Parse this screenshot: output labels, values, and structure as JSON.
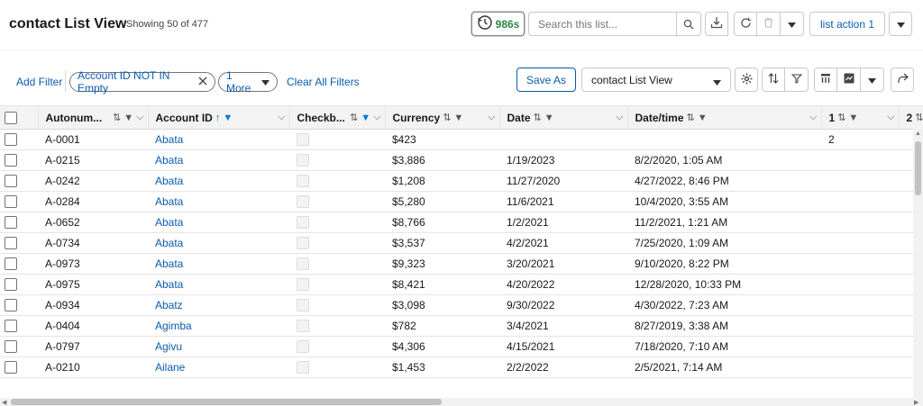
{
  "header": {
    "title": "contact List View",
    "count": "Showing 50 of 477",
    "timer": "986s",
    "search_placeholder": "Search this list...",
    "list_action": "list action 1"
  },
  "filters": {
    "add_filter": "Add Filter",
    "pills": [
      "Account ID NOT IN Empty",
      "1 More"
    ],
    "clear_all": "Clear All Filters",
    "save_as": "Save As",
    "view": "contact List View"
  },
  "table": {
    "columns": [
      "Autonum...",
      "Account ID",
      "Checkb...",
      "Currency",
      "Date",
      "Date/time",
      "1",
      "2"
    ],
    "rows": [
      {
        "auto": "A-0001",
        "account": "Abata",
        "currency": "$423",
        "date": "",
        "datetime": "",
        "c1": "2"
      },
      {
        "auto": "A-0215",
        "account": "Abata",
        "currency": "$3,886",
        "date": "1/19/2023",
        "datetime": "8/2/2020, 1:05 AM",
        "c1": ""
      },
      {
        "auto": "A-0242",
        "account": "Abata",
        "currency": "$1,208",
        "date": "11/27/2020",
        "datetime": "4/27/2022, 8:46 PM",
        "c1": ""
      },
      {
        "auto": "A-0284",
        "account": "Abata",
        "currency": "$5,280",
        "date": "11/6/2021",
        "datetime": "10/4/2020, 3:55 AM",
        "c1": ""
      },
      {
        "auto": "A-0652",
        "account": "Abata",
        "currency": "$8,766",
        "date": "1/2/2021",
        "datetime": "11/2/2021, 1:21 AM",
        "c1": ""
      },
      {
        "auto": "A-0734",
        "account": "Abata",
        "currency": "$3,537",
        "date": "4/2/2021",
        "datetime": "7/25/2020, 1:09 AM",
        "c1": ""
      },
      {
        "auto": "A-0973",
        "account": "Abata",
        "currency": "$9,323",
        "date": "3/20/2021",
        "datetime": "9/10/2020, 8:22 PM",
        "c1": ""
      },
      {
        "auto": "A-0975",
        "account": "Abata",
        "currency": "$8,421",
        "date": "4/20/2022",
        "datetime": "12/28/2020, 10:33 PM",
        "c1": ""
      },
      {
        "auto": "A-0934",
        "account": "Abatz",
        "currency": "$3,098",
        "date": "9/30/2022",
        "datetime": "4/30/2022, 7:23 AM",
        "c1": ""
      },
      {
        "auto": "A-0404",
        "account": "Agimba",
        "currency": "$782",
        "date": "3/4/2021",
        "datetime": "8/27/2019, 3:38 AM",
        "c1": ""
      },
      {
        "auto": "A-0797",
        "account": "Agivu",
        "currency": "$4,306",
        "date": "4/15/2021",
        "datetime": "7/18/2020, 7:10 AM",
        "c1": ""
      },
      {
        "auto": "A-0210",
        "account": "Ailane",
        "currency": "$1,453",
        "date": "2/2/2022",
        "datetime": "2/5/2021, 7:14 AM",
        "c1": ""
      }
    ]
  },
  "colors": {
    "link": "#0b5cab",
    "timer": "#2e844a",
    "sort_active": "#0176d3"
  }
}
